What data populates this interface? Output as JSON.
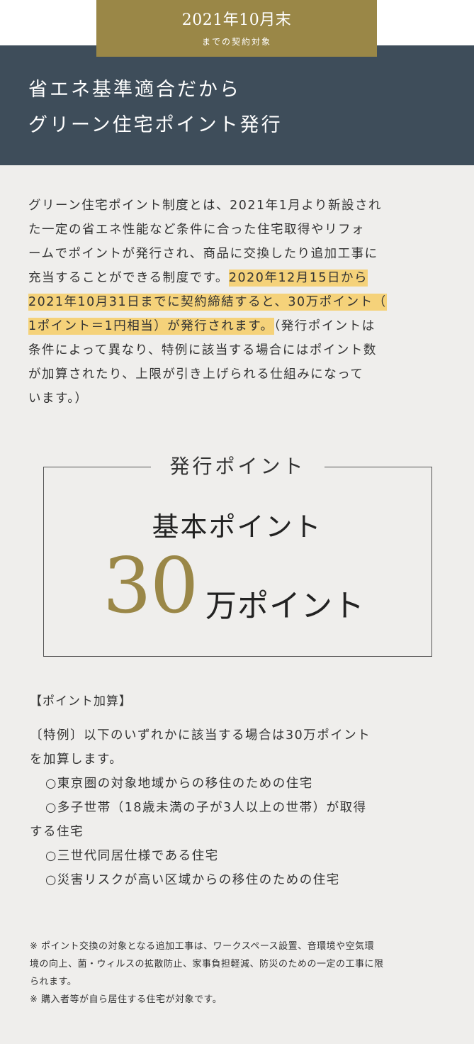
{
  "badge": {
    "main": "2021年10月末",
    "sub": "までの契約対象"
  },
  "header": {
    "line1": "省エネ基準適合だから",
    "line2": "グリーン住宅ポイント発行"
  },
  "intro": {
    "l1": "グリーン住宅ポイント制度とは、2021年1月より新設され",
    "l2": "た一定の省エネ性能など条件に合った住宅取得やリフォ",
    "l3": "ームでポイントが発行され、商品に交換したり追加工事に",
    "l4a": "充当することができる制度です。",
    "l4b": "2020年12月15日から",
    "l5": "2021年10月31日までに契約締結すると、30万ポイント（",
    "l6a": "1ポイント＝1円相当）が発行されます。",
    "l6b": "（発行ポイントは",
    "l7": "条件によって異なり、特例に該当する場合にはポイント数",
    "l8": "が加算されたり、上限が引き上げられる仕組みになって",
    "l9": "います。）"
  },
  "points": {
    "title": "発行ポイント",
    "sub": "基本ポイント",
    "number": "30",
    "unit": "万ポイント"
  },
  "bonus": {
    "heading": "【ポイント加算】",
    "l1": "〔特例〕以下のいずれかに該当する場合は30万ポイント",
    "l2": "を加算します。",
    "l3": "○東京圏の対象地域からの移住のための住宅",
    "l4": "○多子世帯（18歳未満の子が3人以上の世帯）が取得",
    "l5": "する住宅",
    "l6": "○三世代同居仕様である住宅",
    "l7": "○災害リスクが高い区域からの移住のための住宅"
  },
  "notes": {
    "n1a": "※ ポイント交換の対象となる追加工事は、ワークスペース設置、音環境や空気環",
    "n1b": "境の向上、菌・ウィルスの拡散防止、家事負担軽減、防災のための一定の工事に限",
    "n1c": "られます。",
    "n2": "※ 購入者等が自ら居住する住宅が対象です。"
  },
  "colors": {
    "gold": "#9a8747",
    "navy": "#3e4d5a",
    "highlight": "#f5d27a",
    "background": "#efeeec"
  }
}
